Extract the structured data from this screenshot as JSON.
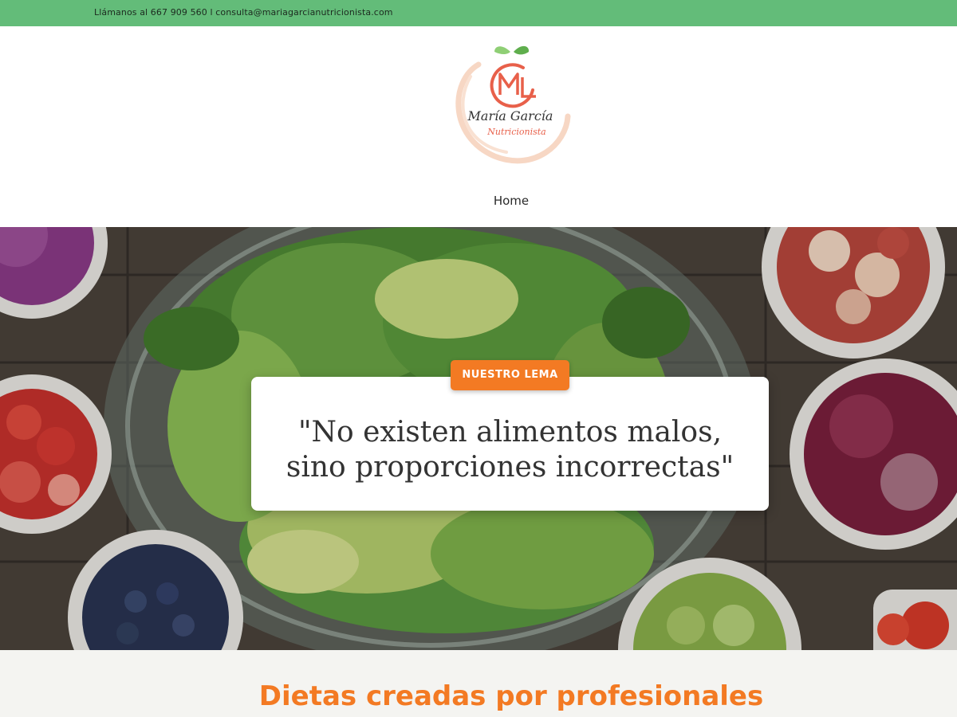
{
  "topbar": {
    "contact_text": "Llámanos al 667 909 560 l consulta@mariagarcianutricionista.com"
  },
  "logo": {
    "brand_name": "María García",
    "tagline": "Nutricionista",
    "monogram": "ML",
    "colors": {
      "primary": "#e8604a",
      "leaf": "#6fbf5a",
      "ring": "#f6d3be"
    }
  },
  "nav": {
    "items": [
      "Home"
    ]
  },
  "hero": {
    "badge": "NUESTRO LEMA",
    "quote_line_1": "\"No existen alimentos malos,",
    "quote_line_2": "sino proporciones incorrectas\""
  },
  "section": {
    "title": "Dietas creadas por profesionales"
  },
  "colors": {
    "topbar": "#63bc79",
    "accent": "#f37a23",
    "section_bg": "#f4f4f1"
  }
}
